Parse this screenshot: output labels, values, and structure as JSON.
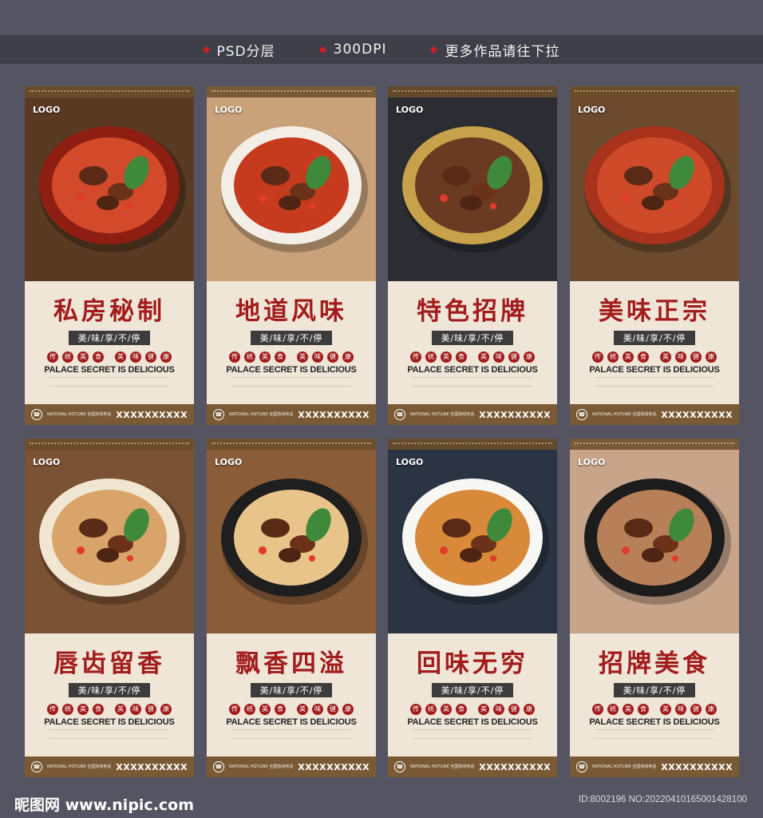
{
  "top_bar": {
    "items": [
      "PSD分层",
      "300DPI",
      "更多作品请往下拉"
    ]
  },
  "posters": [
    {
      "logo": "LOGO",
      "title": "私房秘制",
      "sub": "美/味/享/不/停",
      "badges": [
        "传",
        "统",
        "美",
        "食",
        "美",
        "味",
        "健",
        "康"
      ],
      "eng": "PALACE SECRET IS DELICIOUS",
      "hotline": "NATIONAL HOTLINE 全国热线电话",
      "phone": "XXXXXXXXXX",
      "bg": "#5a3a22",
      "bowl": "#8f1e12",
      "noodle": "#d24a2a"
    },
    {
      "logo": "LOGO",
      "title": "地道风味",
      "sub": "美/味/享/不/停",
      "badges": [
        "传",
        "统",
        "美",
        "食",
        "美",
        "味",
        "健",
        "康"
      ],
      "eng": "PALACE SECRET IS DELICIOUS",
      "hotline": "NATIONAL HOTLINE 全国热线电话",
      "phone": "XXXXXXXXXX",
      "bg": "#c9a27a",
      "bowl": "#f4efe6",
      "noodle": "#c63a1e"
    },
    {
      "logo": "LOGO",
      "title": "特色招牌",
      "sub": "美/味/享/不/停",
      "badges": [
        "传",
        "统",
        "美",
        "食",
        "美",
        "味",
        "健",
        "康"
      ],
      "eng": "PALACE SECRET IS DELICIOUS",
      "hotline": "NATIONAL HOTLINE 全国热线电话",
      "phone": "XXXXXXXXXX",
      "bg": "#2b2d32",
      "bowl": "#c8a24a",
      "noodle": "#6a3a22"
    },
    {
      "logo": "LOGO",
      "title": "美味正宗",
      "sub": "美/味/享/不/停",
      "badges": [
        "传",
        "统",
        "美",
        "食",
        "美",
        "味",
        "健",
        "康"
      ],
      "eng": "PALACE SECRET IS DELICIOUS",
      "hotline": "NATIONAL HOTLINE 全国热线电话",
      "phone": "XXXXXXXXXX",
      "bg": "#6b4a2e",
      "bowl": "#a8321c",
      "noodle": "#cf4a28"
    },
    {
      "logo": "LOGO",
      "title": "唇齿留香",
      "sub": "美/味/享/不/停",
      "badges": [
        "传",
        "统",
        "美",
        "食",
        "美",
        "味",
        "健",
        "康"
      ],
      "eng": "PALACE SECRET IS DELICIOUS",
      "hotline": "NATIONAL HOTLINE 全国热线电话",
      "phone": "XXXXXXXXXX",
      "bg": "#7b5233",
      "bowl": "#f0e6d2",
      "noodle": "#d9a46a"
    },
    {
      "logo": "LOGO",
      "title": "飘香四溢",
      "sub": "美/味/享/不/停",
      "badges": [
        "传",
        "统",
        "美",
        "食",
        "美",
        "味",
        "健",
        "康"
      ],
      "eng": "PALACE SECRET IS DELICIOUS",
      "hotline": "NATIONAL HOTLINE 全国热线电话",
      "phone": "XXXXXXXXXX",
      "bg": "#8a5d38",
      "bowl": "#1e1e1e",
      "noodle": "#e8c48a"
    },
    {
      "logo": "LOGO",
      "title": "回味无穷",
      "sub": "美/味/享/不/停",
      "badges": [
        "传",
        "统",
        "美",
        "食",
        "美",
        "味",
        "健",
        "康"
      ],
      "eng": "PALACE SECRET IS DELICIOUS",
      "hotline": "NATIONAL HOTLINE 全国热线电话",
      "phone": "XXXXXXXXXX",
      "bg": "#2a3442",
      "bowl": "#f7f7f4",
      "noodle": "#d88a3a"
    },
    {
      "logo": "LOGO",
      "title": "招牌美食",
      "sub": "美/味/享/不/停",
      "badges": [
        "传",
        "统",
        "美",
        "食",
        "美",
        "味",
        "健",
        "康"
      ],
      "eng": "PALACE SECRET IS DELICIOUS",
      "hotline": "NATIONAL HOTLINE 全国热线电话",
      "phone": "XXXXXXXXXX",
      "bg": "#c7a48a",
      "bowl": "#1c1c1c",
      "noodle": "#b88058"
    }
  ],
  "footer": {
    "site": "昵图网 www.nipic.com",
    "id": "ID:8002196 NO:20220410165001428100"
  }
}
